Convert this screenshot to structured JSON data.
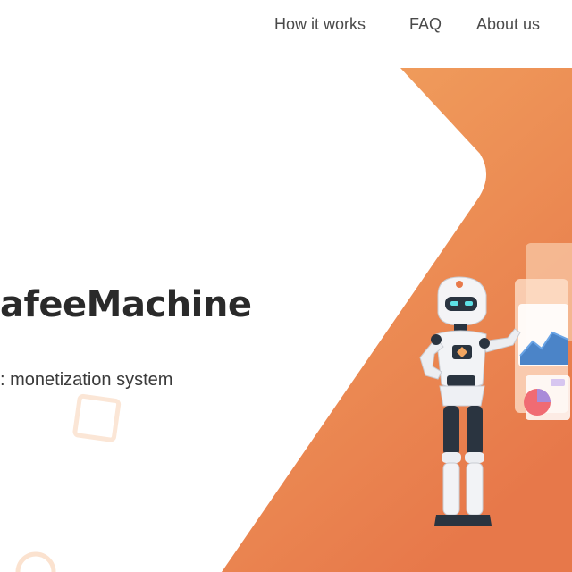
{
  "nav": {
    "items": [
      {
        "label": "How it works"
      },
      {
        "label": "FAQ"
      },
      {
        "label": "About us"
      }
    ]
  },
  "hero": {
    "title": "afeeMachine",
    "subtitle": ": monetization system"
  },
  "colors": {
    "accent_light": "#f2a45f",
    "accent_dark": "#e8794a",
    "text": "#2a2a2a"
  },
  "illustration": {
    "robot": "robot-presenting-icon",
    "dashboard": "dashboard-panels-icon"
  }
}
